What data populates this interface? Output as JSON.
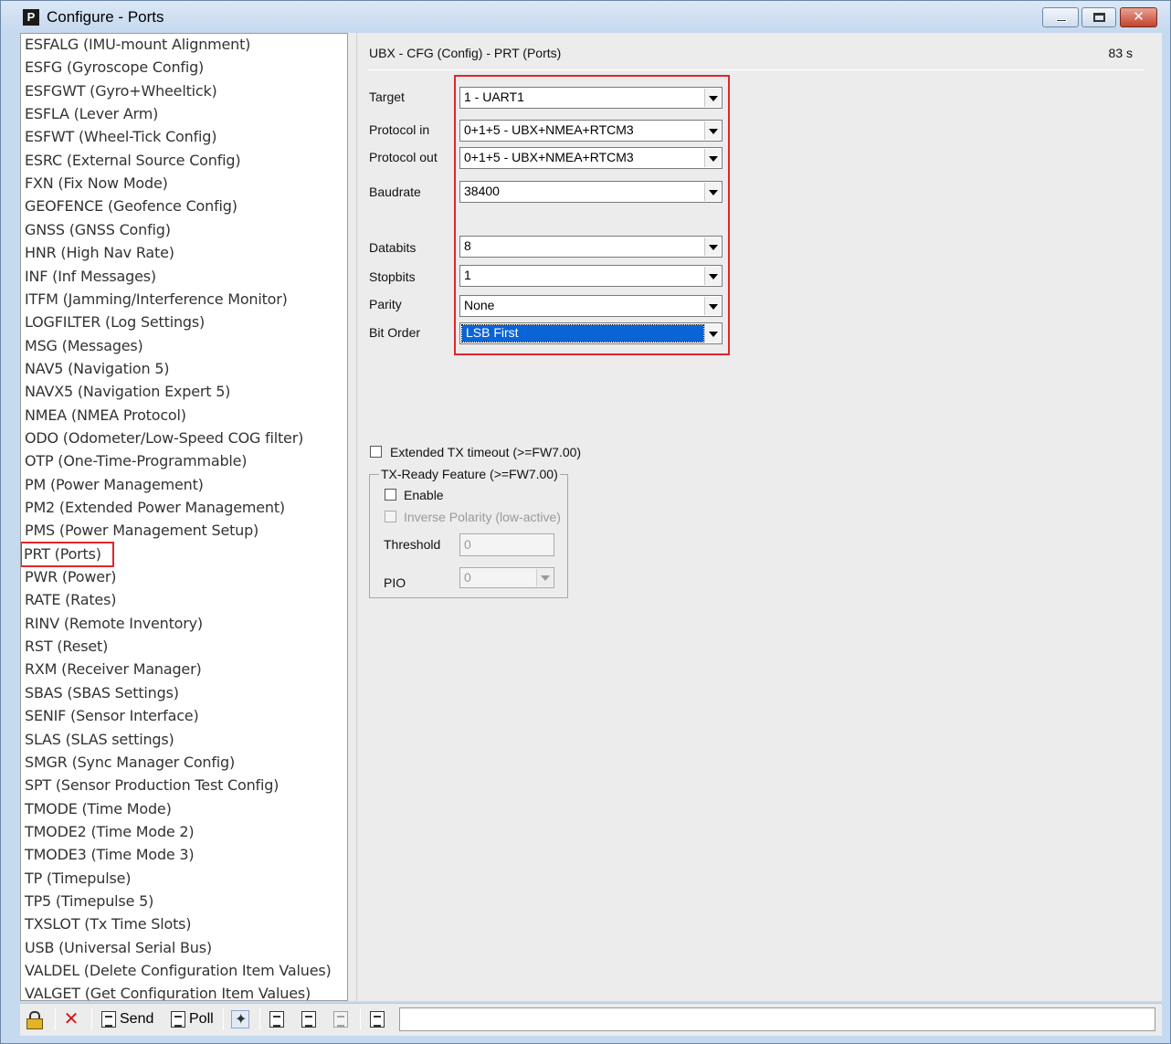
{
  "window": {
    "title": "Configure - Ports",
    "app_icon_letter": "P",
    "controls": {
      "minimize": "minimize",
      "maximize": "maximize",
      "close": "✕"
    }
  },
  "sidebar": {
    "items": [
      "ESFALG (IMU-mount Alignment)",
      "ESFG (Gyroscope Config)",
      "ESFGWT (Gyro+Wheeltick)",
      "ESFLA (Lever Arm)",
      "ESFWT (Wheel-Tick Config)",
      "ESRC (External Source Config)",
      "FXN (Fix Now Mode)",
      "GEOFENCE (Geofence Config)",
      "GNSS (GNSS Config)",
      "HNR (High Nav Rate)",
      "INF (Inf Messages)",
      "ITFM (Jamming/Interference Monitor)",
      "LOGFILTER (Log Settings)",
      "MSG (Messages)",
      "NAV5 (Navigation 5)",
      "NAVX5 (Navigation Expert 5)",
      "NMEA (NMEA Protocol)",
      "ODO (Odometer/Low-Speed COG filter)",
      "OTP (One-Time-Programmable)",
      "PM (Power Management)",
      "PM2 (Extended Power Management)",
      "PMS (Power Management Setup)",
      "PRT (Ports)",
      "PWR (Power)",
      "RATE (Rates)",
      "RINV (Remote Inventory)",
      "RST (Reset)",
      "RXM (Receiver Manager)",
      "SBAS (SBAS Settings)",
      "SENIF (Sensor Interface)",
      "SLAS (SLAS settings)",
      "SMGR (Sync Manager Config)",
      "SPT (Sensor Production Test Config)",
      "TMODE (Time Mode)",
      "TMODE2 (Time Mode 2)",
      "TMODE3 (Time Mode 3)",
      "TP (Timepulse)",
      "TP5 (Timepulse 5)",
      "TXSLOT (Tx Time Slots)",
      "USB (Universal Serial Bus)",
      "VALDEL (Delete Configuration Item Values)",
      "VALGET (Get Configuration Item Values)"
    ],
    "highlighted_item": "PRT (Ports)",
    "scroll_up": "▲",
    "scroll_down": "▼"
  },
  "panel": {
    "title": "UBX - CFG (Config) - PRT (Ports)",
    "timer": "83 s",
    "fields": {
      "target": {
        "label": "Target",
        "value": "1 - UART1"
      },
      "protocol_in": {
        "label": "Protocol in",
        "value": "0+1+5 - UBX+NMEA+RTCM3"
      },
      "protocol_out": {
        "label": "Protocol out",
        "value": "0+1+5 - UBX+NMEA+RTCM3"
      },
      "baudrate": {
        "label": "Baudrate",
        "value": "38400"
      },
      "databits": {
        "label": "Databits",
        "value": "8"
      },
      "stopbits": {
        "label": "Stopbits",
        "value": "1"
      },
      "parity": {
        "label": "Parity",
        "value": "None"
      },
      "bit_order": {
        "label": "Bit Order",
        "value": "LSB First"
      }
    },
    "extended_tx_timeout": {
      "label": "Extended TX timeout (>=FW7.00)",
      "checked": false
    },
    "tx_ready": {
      "title": "TX-Ready Feature (>=FW7.00)",
      "enable": {
        "label": "Enable",
        "checked": false
      },
      "inverse_polarity": {
        "label": "Inverse Polarity (low-active)",
        "checked": false
      },
      "threshold": {
        "label": "Threshold",
        "value": "0"
      },
      "pio": {
        "label": "PIO",
        "value": "0"
      }
    }
  },
  "toolbar": {
    "send_label": "Send",
    "poll_label": "Poll"
  },
  "colors": {
    "highlight_border": "#e0262b",
    "selection_blue": "#0a64d6",
    "titlebar": "#c4d8ee"
  }
}
